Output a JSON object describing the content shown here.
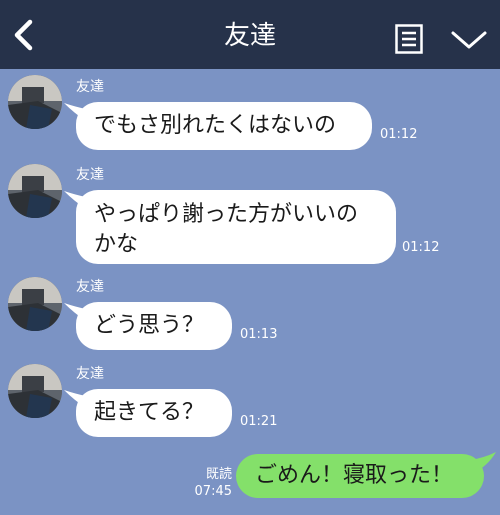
{
  "header": {
    "title": "友達"
  },
  "messages": [
    {
      "sender": "友達",
      "text": "でもさ別れたくはないの",
      "time": "01:12"
    },
    {
      "sender": "友達",
      "line1": "やっぱり謝った方がいいの",
      "line2": "かな",
      "time": "01:12"
    },
    {
      "sender": "友達",
      "text": "どう思う？",
      "time": "01:13"
    },
    {
      "sender": "友達",
      "text": "起きてる？",
      "time": "01:21"
    }
  ],
  "mine": {
    "read_label": "既読",
    "time": "07:45",
    "text": "ごめん！寝取った！"
  },
  "colors": {
    "header_bg": "#26324a",
    "chat_bg": "#7b93c4",
    "incoming_bubble": "#ffffff",
    "outgoing_bubble": "#84e06a"
  },
  "icons": [
    "back-chevron-icon",
    "menu-list-icon",
    "chevron-down-icon",
    "avatar-photo"
  ]
}
